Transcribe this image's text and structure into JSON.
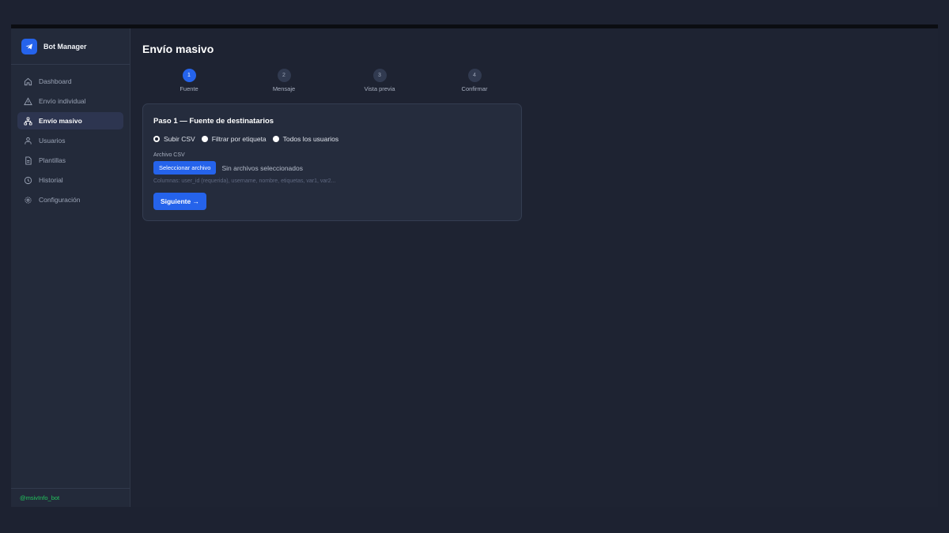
{
  "app": {
    "name": "Bot Manager",
    "accent": "#2563eb",
    "footer_handle": "@msivInfo_bot",
    "footer_color": "#22c55e"
  },
  "sidebar": {
    "items": [
      {
        "label": "Dashboard",
        "icon": "home-icon",
        "active": false
      },
      {
        "label": "Envío individual",
        "icon": "send-icon",
        "active": false
      },
      {
        "label": "Envío masivo",
        "icon": "broadcast-icon",
        "active": true
      },
      {
        "label": "Usuarios",
        "icon": "users-icon",
        "active": false
      },
      {
        "label": "Plantillas",
        "icon": "document-icon",
        "active": false
      },
      {
        "label": "Historial",
        "icon": "clock-icon",
        "active": false
      },
      {
        "label": "Configuración",
        "icon": "gear-icon",
        "active": false
      }
    ]
  },
  "page": {
    "title": "Envío masivo"
  },
  "steps": [
    {
      "number": "1",
      "label": "Fuente",
      "active": true
    },
    {
      "number": "2",
      "label": "Mensaje",
      "active": false
    },
    {
      "number": "3",
      "label": "Vista previa",
      "active": false
    },
    {
      "number": "4",
      "label": "Confirmar",
      "active": false
    }
  ],
  "card": {
    "title": "Paso 1 — Fuente de destinatarios",
    "options": [
      {
        "label": "Subir CSV",
        "checked": true
      },
      {
        "label": "Filtrar por etiqueta",
        "checked": false
      },
      {
        "label": "Todos los usuarios",
        "checked": false
      }
    ],
    "file_label": "Archivo CSV",
    "file_button": "Seleccionar archivo",
    "file_status": "Sin archivos seleccionados",
    "hint": "Columnas: user_id (requerida), username, nombre, etiquetas, var1, var2...",
    "next_button": "Siguiente →"
  }
}
